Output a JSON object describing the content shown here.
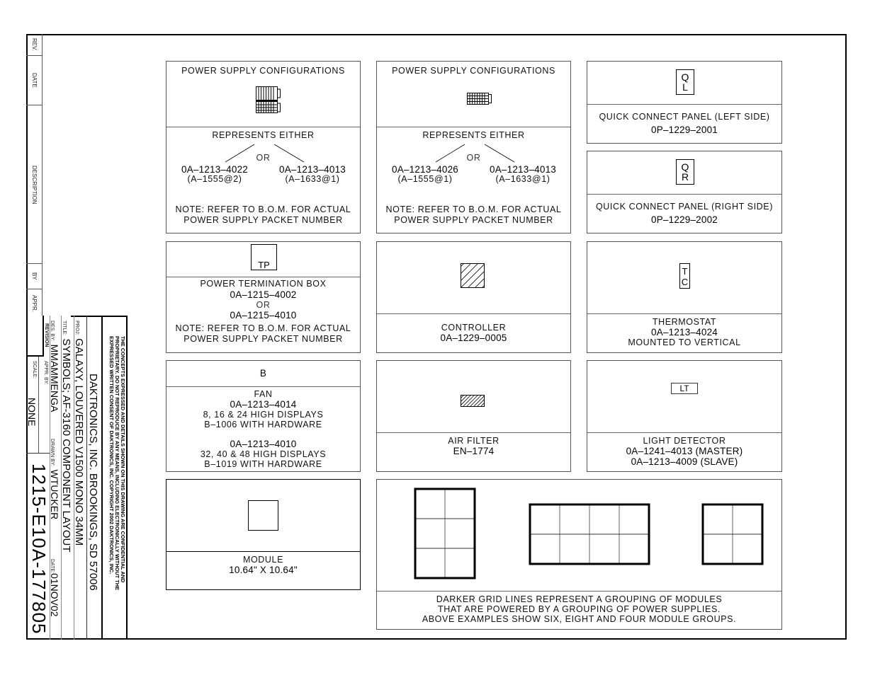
{
  "revision_block": {
    "labels": [
      "REV.",
      "DATE",
      "DESCRIPTION",
      "BY",
      "APPR."
    ]
  },
  "title_block": {
    "legal_lines": [
      "THE CONCEPTS EXPRESSED AND DETAILS SHOWN ON THIS DRAWING ARE CONFIDENTIAL AND",
      "PROPRIETARY. DO NOT REPRODUCE BY ANY MEANS, INCLUDING ELECTRONICALLY WITHOUT THE",
      "EXPRESSED WRITTEN CONSENT OF DAKTRONICS, INC.          COPYRIGHT 2002 DAKTRONICS, INC."
    ],
    "company": "DAKTRONICS, INC.   BROOKINGS, SD 57006",
    "proj_label": "PROJ:",
    "proj_value": "GALAXY, LOUVERED V1500 MONO 34MM",
    "title_label": "TITLE:",
    "title_value": "SYMBOLS; AF-3160 COMPONENT LAYOUT",
    "des_by_label": "DES. BY:",
    "des_by_value": "MMAMMENGA",
    "drawn_by_label": "DRAWN BY:",
    "drawn_by_value": "WTUCKER",
    "date_label": "DATE:",
    "date_value": "01NOV02",
    "revision_label": "REVISION",
    "appr_by_label": "APPR. BY:",
    "scale_label": "SCALE:",
    "scale_value": "NONE",
    "drawing_number": "1215-E10A-177805"
  },
  "panels": {
    "ps1": {
      "header": "POWER SUPPLY CONFIGURATIONS",
      "represents": "REPRESENTS EITHER",
      "or": "OR",
      "left_part": "0A–1213–4022",
      "left_sub": "(A–1555@2)",
      "right_part": "0A–1213–4013",
      "right_sub": "(A–1633@1)",
      "note1": "NOTE: REFER TO B.O.M. FOR ACTUAL",
      "note2": "POWER SUPPLY PACKET NUMBER"
    },
    "ps2": {
      "header": "POWER SUPPLY CONFIGURATIONS",
      "represents": "REPRESENTS EITHER",
      "or": "OR",
      "left_part": "0A–1213–4026",
      "left_sub": "(A–1555@1)",
      "right_part": "0A–1213–4013",
      "right_sub": "(A–1633@1)",
      "note1": "NOTE: REFER TO B.O.M. FOR ACTUAL",
      "note2": "POWER SUPPLY PACKET NUMBER"
    },
    "ql": {
      "symbol_top": "Q",
      "symbol_bottom": "L",
      "name": "QUICK CONNECT PANEL (LEFT SIDE)",
      "part": "0P–1229–2001"
    },
    "qr": {
      "symbol_top": "Q",
      "symbol_bottom": "R",
      "name": "QUICK CONNECT PANEL (RIGHT SIDE)",
      "part": "0P–1229–2002"
    },
    "tp": {
      "symbol": "TP",
      "name": "POWER TERMINATION BOX",
      "part1": "0A–1215–4002",
      "or": "OR",
      "part2": "0A–1215–4010",
      "note1": "NOTE: REFER TO B.O.M. FOR ACTUAL",
      "note2": "POWER SUPPLY PACKET NUMBER"
    },
    "controller": {
      "name": "CONTROLLER",
      "part": "0A–1229–0005"
    },
    "thermostat": {
      "symbol_top": "T",
      "symbol_bottom": "C",
      "name": "THERMOSTAT",
      "part": "0A–1213–4024",
      "note": "MOUNTED TO VERTICAL"
    },
    "fan": {
      "symbol": "B",
      "name": "FAN",
      "part1": "0A–1213–4014",
      "desc1a": "8, 16 & 24 HIGH DISPLAYS",
      "desc1b": "B–1006 WITH HARDWARE",
      "part2": "0A–1213–4010",
      "desc2a": "32, 40 & 48 HIGH DISPLAYS",
      "desc2b": "B–1019 WITH HARDWARE"
    },
    "air_filter": {
      "name": "AIR FILTER",
      "part": "EN–1774"
    },
    "light_detector": {
      "symbol": "LT",
      "name": "LIGHT DETECTOR",
      "part1": "0A–1241–4013 (MASTER)",
      "part2": "0A–1213–4009 (SLAVE)"
    },
    "module": {
      "name": "MODULE",
      "size": "10.64\" X 10.64\""
    },
    "groups": {
      "line1": "DARKER GRID LINES REPRESENT A GROUPING OF MODULES",
      "line2": "THAT ARE POWERED BY A GROUPING OF POWER SUPPLIES.",
      "line3": "ABOVE EXAMPLES SHOW SIX, EIGHT AND FOUR MODULE GROUPS.",
      "examples": [
        {
          "label": "six",
          "cols": 2,
          "rows": 3
        },
        {
          "label": "eight",
          "cols": 4,
          "rows": 2
        },
        {
          "label": "four",
          "cols": 2,
          "rows": 2
        }
      ]
    }
  }
}
